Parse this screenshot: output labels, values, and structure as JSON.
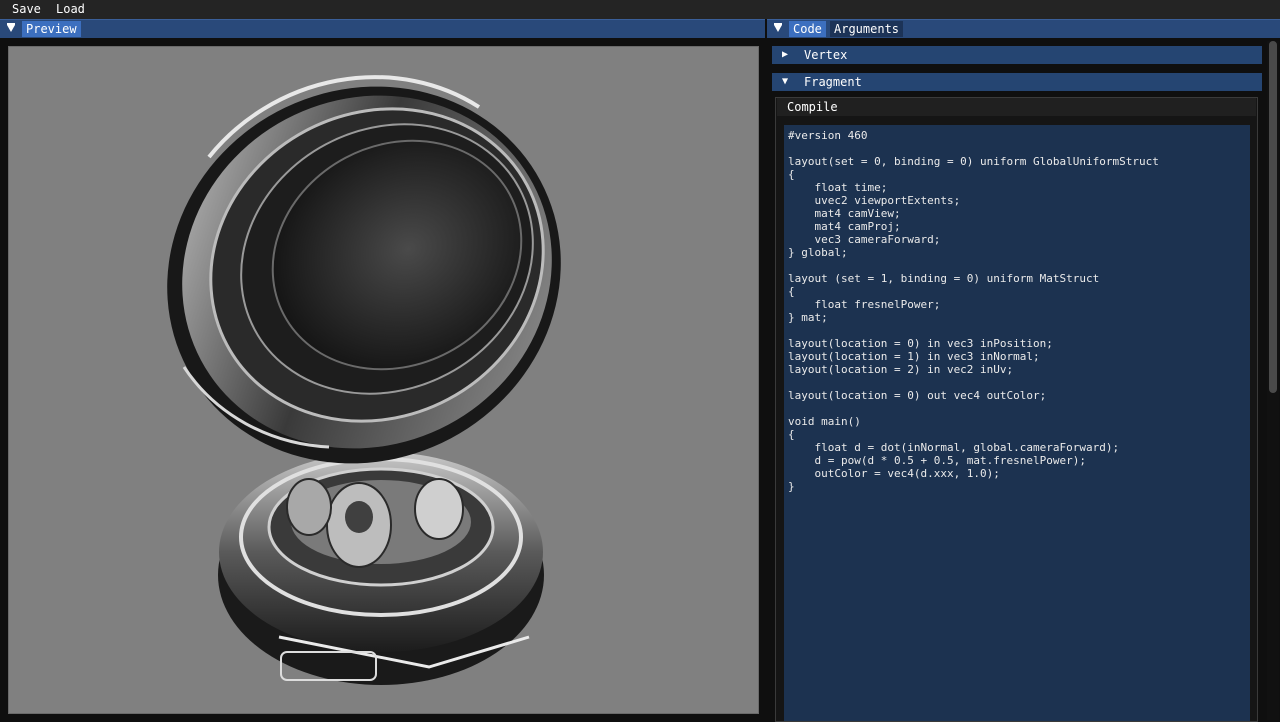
{
  "menu": {
    "save_label": "Save",
    "load_label": "Load"
  },
  "preview_window": {
    "tab_label": "Preview"
  },
  "code_window": {
    "tabs": [
      {
        "label": "Code",
        "active": true
      },
      {
        "label": "Arguments",
        "active": false
      }
    ],
    "sections": {
      "vertex": {
        "label": "Vertex",
        "expanded": false
      },
      "fragment": {
        "label": "Fragment",
        "expanded": true
      }
    },
    "compile_label": "Compile",
    "fragment_source": "#version 460\n\nlayout(set = 0, binding = 0) uniform GlobalUniformStruct\n{\n    float time;\n    uvec2 viewportExtents;\n    mat4 camView;\n    mat4 camProj;\n    vec3 cameraForward;\n} global;\n\nlayout (set = 1, binding = 0) uniform MatStruct\n{\n    float fresnelPower;\n} mat;\n\nlayout(location = 0) in vec3 inPosition;\nlayout(location = 1) in vec3 inNormal;\nlayout(location = 2) in vec2 inUv;\n\nlayout(location = 0) out vec4 outColor;\n\nvoid main()\n{\n    float d = dot(inNormal, global.cameraForward);\n    d = pow(d * 0.5 + 0.5, mat.fresnelPower);\n    outColor = vec4(d.xxx, 1.0);\n}"
  },
  "colors": {
    "title_active": "#29497a",
    "tab_active": "#3c6fbf",
    "tab_inactive": "#1c3357",
    "section_header": "#254572",
    "code_background": "#1c3250",
    "viewport_background": "#808080"
  },
  "icons": {
    "preview_collapse": "collapse-triangle-icon",
    "code_collapse": "collapse-triangle-icon",
    "vertex_arrow": "expand-arrow-right-icon",
    "fragment_arrow": "expand-arrow-down-icon"
  }
}
